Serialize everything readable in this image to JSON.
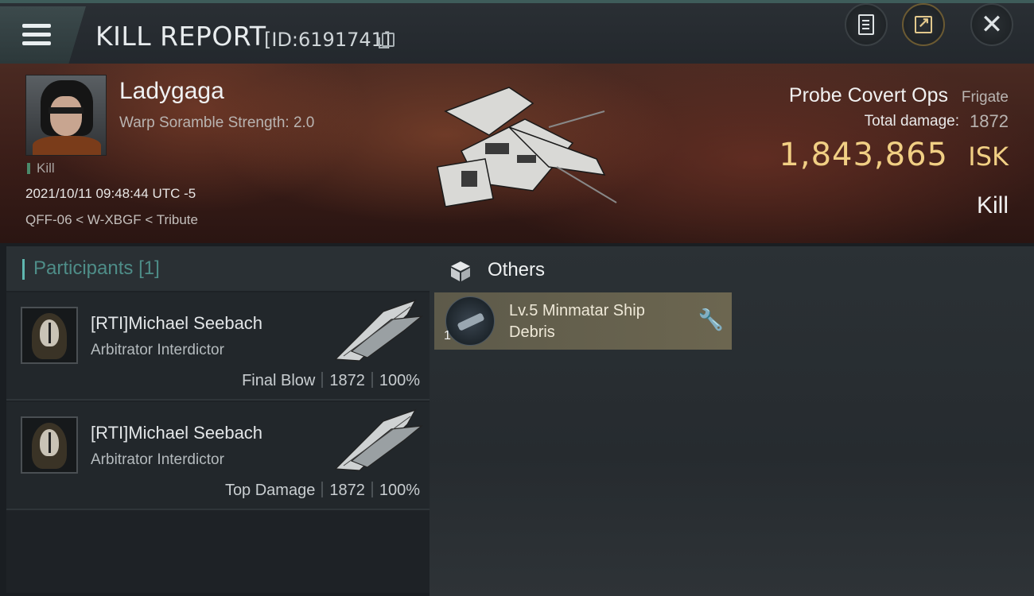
{
  "header": {
    "title": "KILL REPORT",
    "report_id": "[ID:6191741]",
    "icons": [
      "menu-icon",
      "copy-icon",
      "report-icon",
      "share-icon",
      "close-icon"
    ]
  },
  "victim": {
    "name": "Ladygaga",
    "warp_scramble": "Warp Soramble Strength: 2.0",
    "tag": "Kill",
    "datetime": "2021/10/11 09:48:44 UTC -5",
    "location": "QFF-06 < W-XBGF < Tribute",
    "ship_name": "Probe Covert Ops",
    "ship_class": "Frigate",
    "damage_label": "Total damage:",
    "damage_value": "1872",
    "isk_value": "1,843,865",
    "isk_unit": "ISK",
    "result": "Kill"
  },
  "participants": {
    "title": "Participants",
    "count": "[1]",
    "rows": [
      {
        "name": "[RTI]Michael Seebach",
        "ship": "Arbitrator Interdictor",
        "role": "Final Blow",
        "damage": "1872",
        "percent": "100%"
      },
      {
        "name": "[RTI]Michael Seebach",
        "ship": "Arbitrator Interdictor",
        "role": "Top Damage",
        "damage": "1872",
        "percent": "100%"
      }
    ]
  },
  "others": {
    "title": "Others",
    "items": [
      {
        "name": "Lv.5 Minmatar Ship Debris",
        "qty": "1"
      }
    ]
  },
  "colors": {
    "accent_teal": "#5fb7b0",
    "isk_gold": "#f1cf84",
    "item_card": "#6c6650"
  }
}
